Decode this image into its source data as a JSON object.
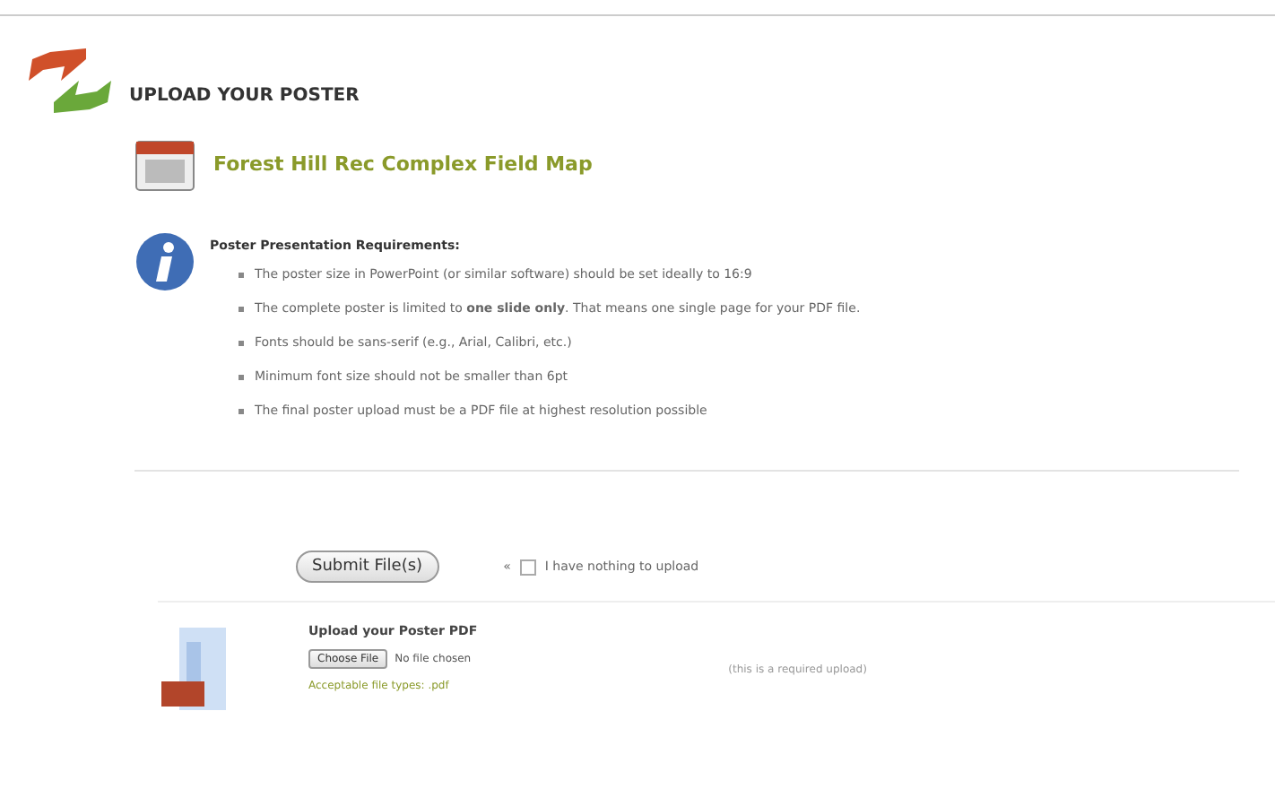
{
  "page_title": "UPLOAD YOUR POSTER",
  "document_link": "Forest Hill Rec Complex Field Map",
  "requirements": {
    "heading": "Poster Presentation Requirements:",
    "items": [
      "The poster size in PowerPoint (or similar software) should be set ideally to 16:9",
      "The complete poster is limited to **one slide only**. That means one single page for your PDF file.",
      "Fonts should be sans-serif (e.g., Arial, Calibri, etc.)",
      "Minimum font size should not be smaller than 6pt",
      "The final poster upload must be a PDF file at highest resolution possible"
    ]
  },
  "submit_button": "Submit File(s)",
  "nothing_to_upload": {
    "arrow": "«",
    "label": "I have nothing to upload",
    "checked": false
  },
  "upload": {
    "title": "Upload your Poster PDF",
    "choose_button": "Choose File",
    "file_status": "No file chosen",
    "file_types": "Acceptable file types: .pdf",
    "required_note": "(this is a required upload)"
  }
}
